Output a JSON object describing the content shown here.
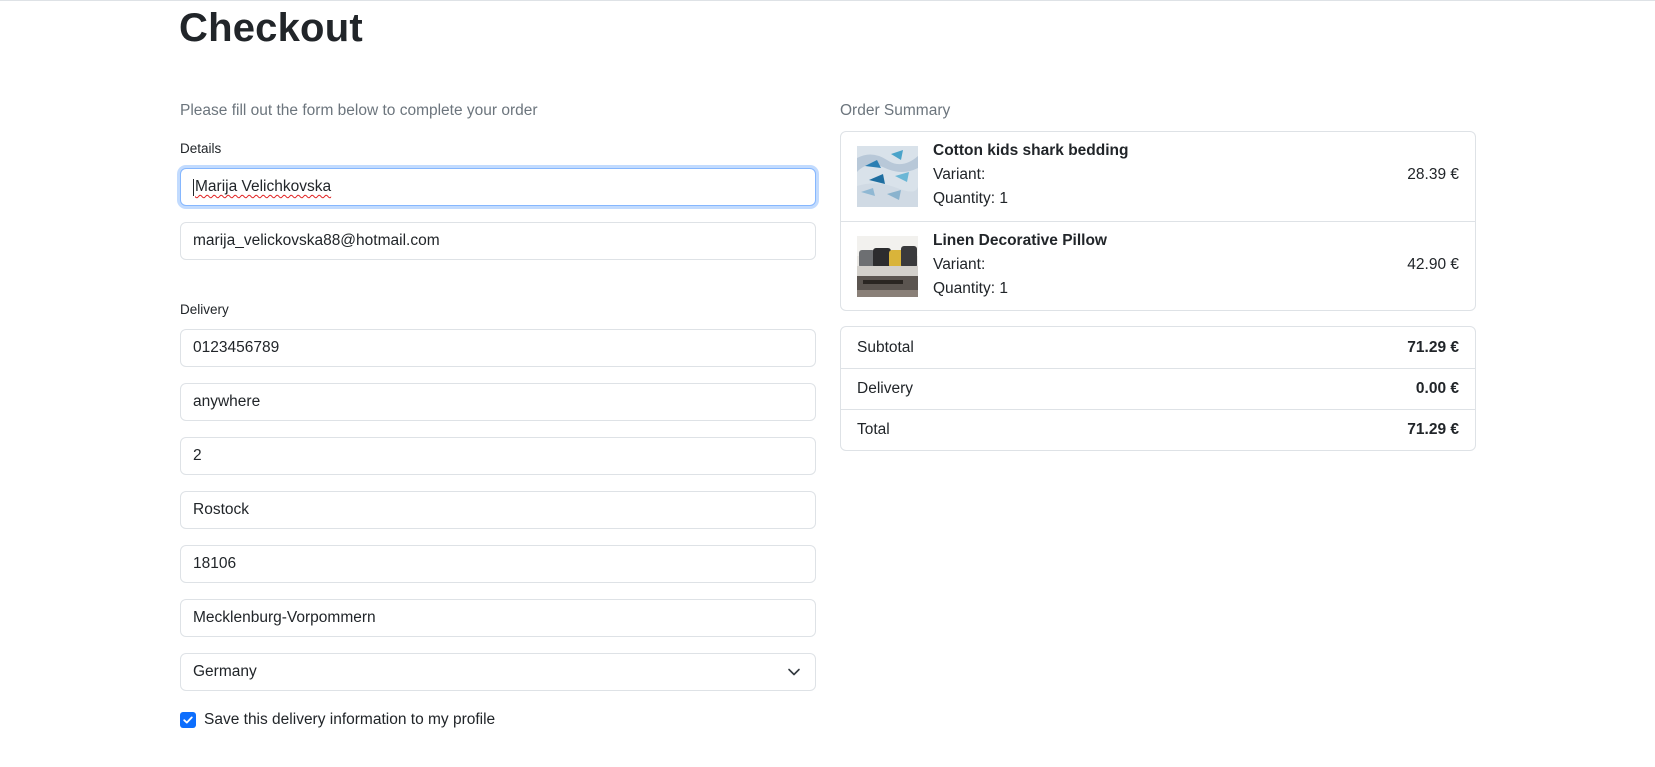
{
  "page": {
    "title": "Checkout"
  },
  "form": {
    "intro": "Please fill out the form below to complete your order",
    "details_label": "Details",
    "name": "Marija Velichkovska",
    "email": "marija_velickovska88@hotmail.com",
    "delivery_label": "Delivery",
    "phone": "0123456789",
    "street": "anywhere",
    "house_number": "2",
    "city": "Rostock",
    "postal_code": "18106",
    "state": "Mecklenburg-Vorpommern",
    "country": "Germany",
    "save_checkbox": {
      "label": "Save this delivery information to my profile",
      "checked": true
    }
  },
  "summary": {
    "label": "Order Summary",
    "items": [
      {
        "name": "Cotton kids shark bedding",
        "variant": "Variant:",
        "quantity": "Quantity: 1",
        "price": "28.39 €",
        "icon": "shark-bedding-thumbnail"
      },
      {
        "name": "Linen Decorative Pillow",
        "variant": "Variant:",
        "quantity": "Quantity: 1",
        "price": "42.90 €",
        "icon": "pillow-thumbnail"
      }
    ],
    "totals": [
      {
        "label": "Subtotal",
        "value": "71.29 €"
      },
      {
        "label": "Delivery",
        "value": "0.00 €"
      },
      {
        "label": "Total",
        "value": "71.29 €"
      }
    ]
  },
  "colors": {
    "accent": "#0d6efd",
    "focus_border": "#86b7fe",
    "border": "#dee2e6",
    "muted_text": "#6c757d"
  }
}
